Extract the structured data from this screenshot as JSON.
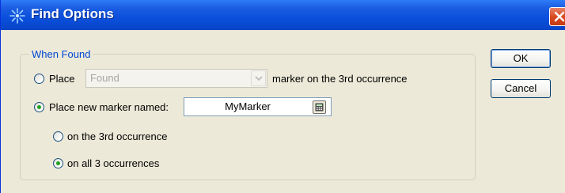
{
  "window": {
    "title": "Find Options",
    "icon": "agilent-spark-icon",
    "close_icon": "close-icon"
  },
  "group": {
    "legend": "When Found"
  },
  "option_place": {
    "label": "Place",
    "selected": false,
    "combo_value": "Found",
    "combo_enabled": false,
    "suffix": "marker on the 3rd occurrence"
  },
  "option_new": {
    "label": "Place new marker named:",
    "selected": true,
    "value": "MyMarker",
    "calc_icon": "calculator-icon"
  },
  "occurrence": {
    "third_label": "on the 3rd occurrence",
    "third_selected": false,
    "all_label": "on all 3 occurrences",
    "all_selected": true
  },
  "buttons": {
    "ok": "OK",
    "cancel": "Cancel"
  },
  "colors": {
    "title_bar": "#0a4fdc",
    "legend_text": "#0046d5",
    "radio_dot": "#21a121",
    "close_button": "#d8481e"
  }
}
